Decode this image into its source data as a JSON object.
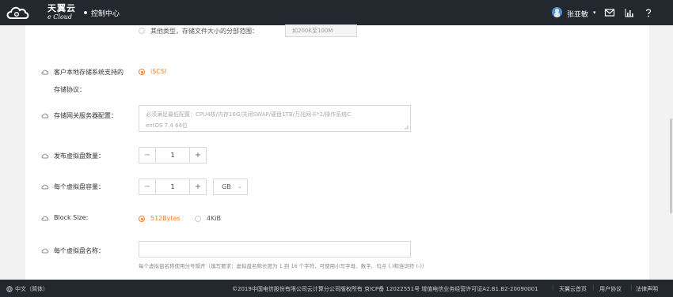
{
  "header": {
    "brand_cn": "天翼云",
    "brand_en": "e Cloud",
    "console": "控制中心",
    "username": "张亚敏",
    "caret": "▾",
    "icons": [
      "mail-icon",
      "bar-chart-icon",
      "help-icon"
    ]
  },
  "form": {
    "other_type": {
      "option_label": "其他类型，存储文件大小的分部范围：",
      "placeholder": "如200K至100M"
    },
    "protocol": {
      "label_line1": "客户本地存储系统支持的",
      "label_line2": "存储协议：",
      "option": "iSCSI"
    },
    "gateway_config": {
      "label": "存储网关服务器配置：",
      "placeholder_line1": "必须满足最低配置：CPU4核/内存16G/关闭SWAP/硬盘1TB/万兆网卡*2/操作系统C",
      "placeholder_line2": "entOS 7.4 64位"
    },
    "disk_count": {
      "label": "发布虚拟盘数量：",
      "minus": "−",
      "value": "1",
      "plus": "+"
    },
    "disk_capacity": {
      "label": "每个虚拟盘容量：",
      "minus": "−",
      "value": "1",
      "plus": "+",
      "unit": "GB",
      "chevron": "⌄"
    },
    "block_size": {
      "label": "Block Size:",
      "options": [
        "512Bytes",
        "4KiB"
      ],
      "selected": "512Bytes"
    },
    "disk_name": {
      "label": "每个虚拟盘名称：",
      "hint": "每个虚拟盘名称使用分号隔开（填写要求：虚拟盘名称长度为 1 到 16 个字符，可使用小写字母、数字、句点 (.)和连词符 (-)）"
    }
  },
  "footer": {
    "language": "中文（简体）",
    "copyright": "©2019中国电信股份有限公司云计算分公司版权所有 京ICP备 12022551号 增值电信业务经营许可证A2.B1.B2-20090001",
    "links": [
      "天翼云首页",
      "用户协议",
      "法律声明"
    ],
    "separator": "|"
  },
  "colors": {
    "accent": "#ff7d28",
    "topbar_bg": "#23272e",
    "page_bg": "#f2f2f2"
  }
}
